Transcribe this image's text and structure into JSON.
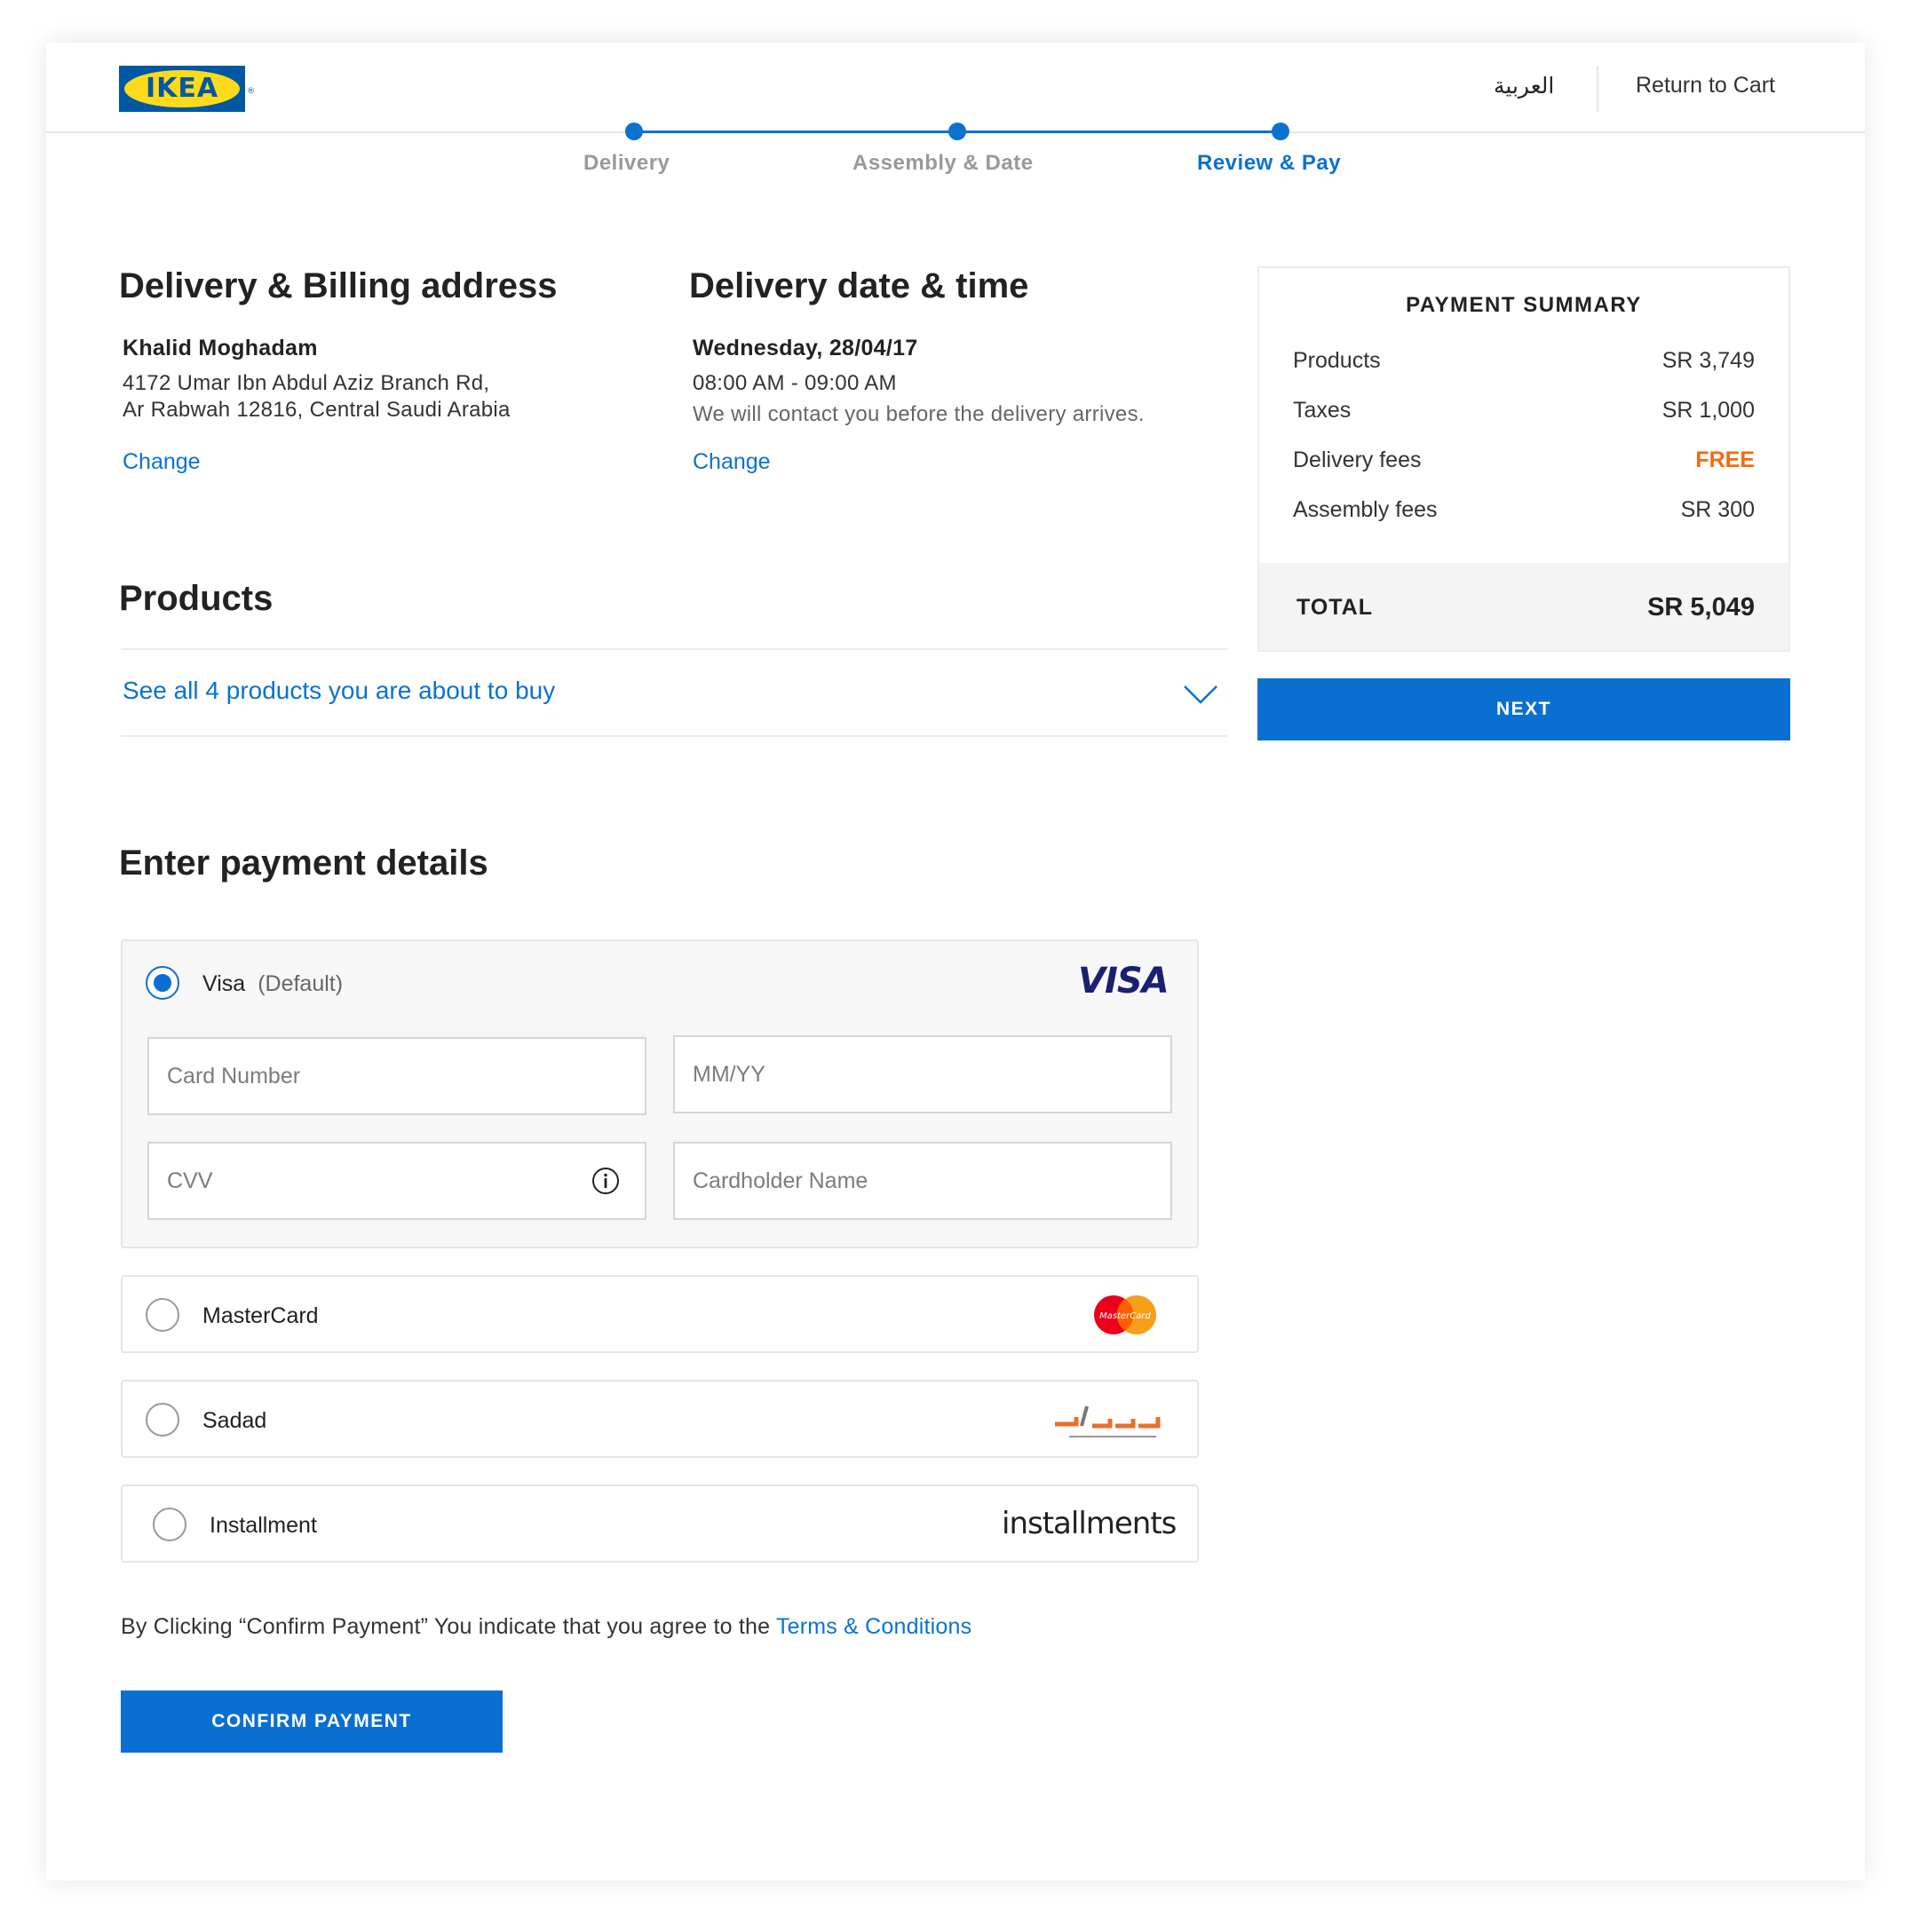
{
  "header": {
    "logo_text": "IKEA",
    "language_label": "العربية",
    "return_label": "Return to Cart"
  },
  "stepper": {
    "steps": [
      {
        "label": "Delivery",
        "state": "done"
      },
      {
        "label": "Assembly & Date",
        "state": "done"
      },
      {
        "label": "Review & Pay",
        "state": "active"
      }
    ]
  },
  "address": {
    "title": "Delivery & Billing address",
    "name": "Khalid Moghadam",
    "line1": "4172 Umar Ibn Abdul Aziz Branch Rd,",
    "line2": "Ar Rabwah 12816, Central Saudi Arabia",
    "change_label": "Change"
  },
  "delivery_time": {
    "title": "Delivery date & time",
    "date": "Wednesday, 28/04/17",
    "time": "08:00 AM - 09:00 AM",
    "note": "We will contact you before the delivery arrives.",
    "change_label": "Change"
  },
  "products": {
    "title": "Products",
    "toggle_label": "See all 4 products you are about to buy"
  },
  "summary": {
    "title": "PAYMENT  SUMMARY",
    "rows": [
      {
        "label": "Products",
        "value": "SR 3,749"
      },
      {
        "label": "Taxes",
        "value": "SR 1,000"
      },
      {
        "label": "Delivery fees",
        "value": "FREE"
      },
      {
        "label": "Assembly fees",
        "value": "SR 300"
      }
    ],
    "total_label": "TOTAL",
    "total_value": "SR 5,049",
    "next_label": "NEXT"
  },
  "payment": {
    "title": "Enter payment details",
    "methods": [
      {
        "label": "Visa",
        "note": "(Default)",
        "selected": true,
        "logo": "VISA"
      },
      {
        "label": "MasterCard",
        "selected": false,
        "logo": "MasterCard"
      },
      {
        "label": "Sadad",
        "selected": false,
        "logo": "sadad-logo"
      },
      {
        "label": "Installment",
        "selected": false,
        "logo": "installments"
      }
    ],
    "fields": {
      "card_number_placeholder": "Card Number",
      "expiry_placeholder": "MM/YY",
      "cvv_placeholder": "CVV",
      "cardholder_placeholder": "Cardholder Name"
    },
    "terms_text": "By Clicking “Confirm Payment” You indicate that you agree to the",
    "terms_link": "Terms & Conditions",
    "confirm_label": "CONFIRM PAYMENT"
  },
  "colors": {
    "accent": "#0b72d0",
    "free": "#f26b11",
    "ikea_blue": "#0058a3",
    "ikea_yellow": "#ffda1a"
  }
}
